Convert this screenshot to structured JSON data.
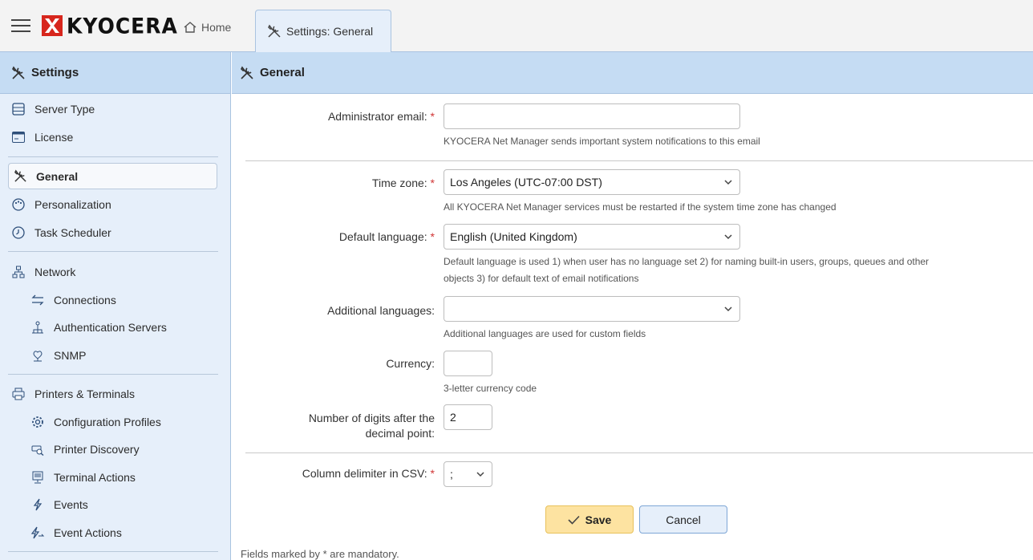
{
  "app": {
    "logo_text": "KYOCERA",
    "brand_color": "#d7261d",
    "accent_color": "#c5dcf3"
  },
  "tabs": {
    "home_label": "Home",
    "active_label": "Settings: General"
  },
  "sidebar": {
    "title": "Settings",
    "items": [
      {
        "label": "Server Type",
        "icon": "server-icon"
      },
      {
        "label": "License",
        "icon": "license-card-icon"
      },
      {
        "label": "General",
        "icon": "tools-icon",
        "active": true
      },
      {
        "label": "Personalization",
        "icon": "palette-icon"
      },
      {
        "label": "Task Scheduler",
        "icon": "clock-icon"
      },
      {
        "label": "Network",
        "icon": "network-icon"
      },
      {
        "label": "Connections",
        "icon": "arrows-exchange-icon"
      },
      {
        "label": "Authentication Servers",
        "icon": "auth-server-icon"
      },
      {
        "label": "SNMP",
        "icon": "snmp-icon"
      },
      {
        "label": "Printers & Terminals",
        "icon": "printer-icon"
      },
      {
        "label": "Configuration Profiles",
        "icon": "gear-icon"
      },
      {
        "label": "Printer Discovery",
        "icon": "printer-search-icon"
      },
      {
        "label": "Terminal Actions",
        "icon": "terminal-icon"
      },
      {
        "label": "Events",
        "icon": "lightning-icon"
      },
      {
        "label": "Event Actions",
        "icon": "lightning-arrow-icon"
      }
    ]
  },
  "main": {
    "title": "General",
    "form": {
      "admin_email": {
        "label": "Administrator email:",
        "value": "",
        "hint": "KYOCERA Net Manager sends important system notifications to this email"
      },
      "time_zone": {
        "label": "Time zone:",
        "value": "Los Angeles (UTC-07:00 DST)",
        "hint": "All KYOCERA Net Manager services must be restarted if the system time zone has changed"
      },
      "default_language": {
        "label": "Default language:",
        "value": "English (United Kingdom)",
        "hint_line1": "Default language is used 1) when user has no language set 2) for naming built-in users, groups, queues and other",
        "hint_line2": "objects 3) for default text of email notifications"
      },
      "additional_languages": {
        "label": "Additional languages:",
        "value": "",
        "hint": "Additional languages are used for custom fields"
      },
      "currency": {
        "label": "Currency:",
        "value": "",
        "hint": "3-letter currency code"
      },
      "digits": {
        "label_line1": "Number of digits after the",
        "label_line2": "decimal point:",
        "value": "2"
      },
      "csv_delimiter": {
        "label": "Column delimiter in CSV:",
        "value": ";"
      },
      "required_mark": "*"
    },
    "buttons": {
      "save": "Save",
      "cancel": "Cancel"
    },
    "footnote": "Fields marked by * are mandatory."
  }
}
